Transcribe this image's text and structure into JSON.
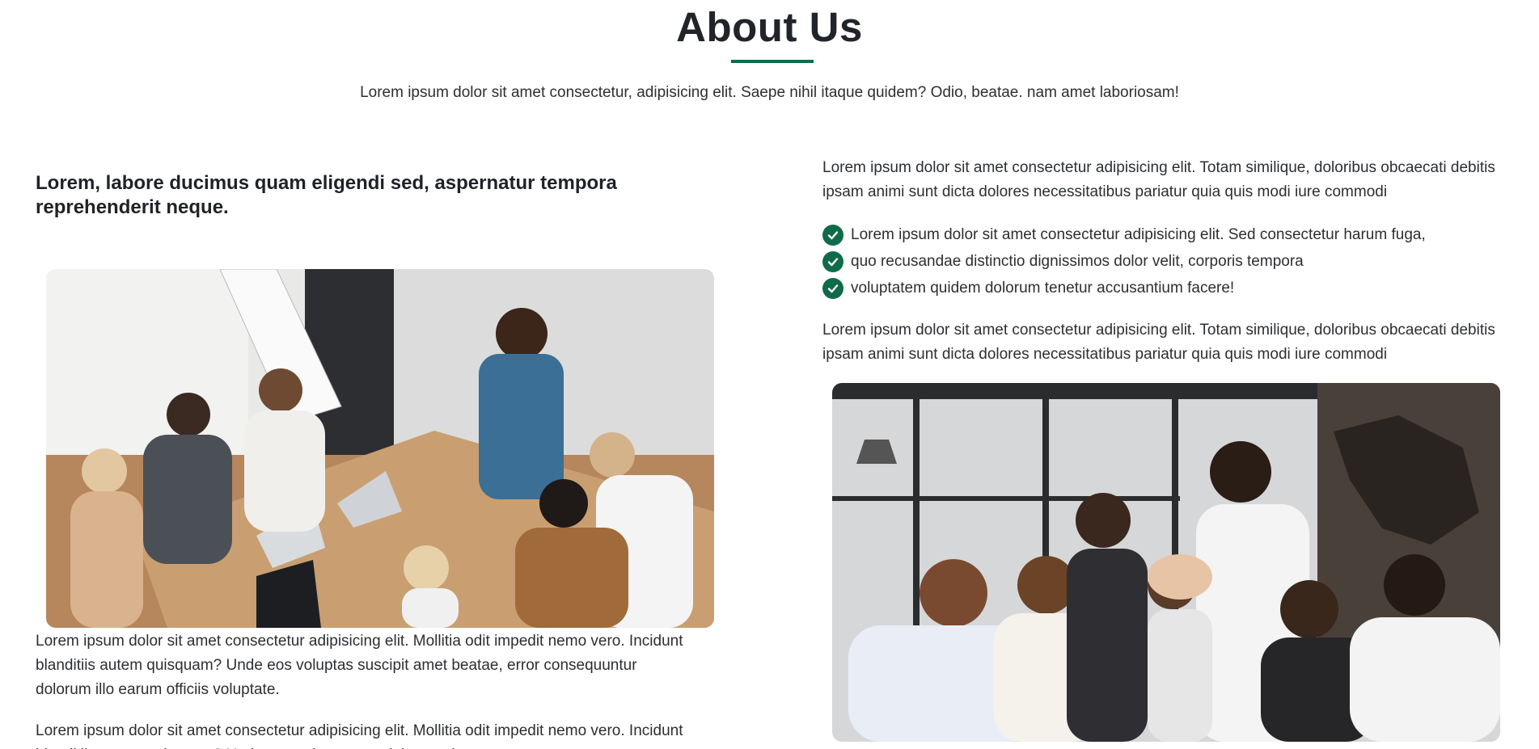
{
  "header": {
    "title": "About Us",
    "subtitle": "Lorem ipsum dolor sit amet consectetur, adipisicing elit. Saepe nihil itaque quidem? Odio, beatae. nam amet laboriosam!"
  },
  "left": {
    "heading": "Lorem, labore ducimus quam eligendi sed, aspernatur tempora reprehenderit neque.",
    "image": "business-meeting-photo",
    "paragraphs": [
      "Lorem ipsum dolor sit amet consectetur adipisicing elit. Mollitia odit impedit nemo vero. Incidunt blanditiis autem quisquam? Unde eos voluptas suscipit amet beatae, error consequuntur dolorum illo earum officiis voluptate.",
      "Lorem ipsum dolor sit amet consectetur adipisicing elit. Mollitia odit impedit nemo vero. Incidunt blanditiis autem quisquam? Unde eos voluptas suscipit amet beatae, error"
    ]
  },
  "right": {
    "intro": "Lorem ipsum dolor sit amet consectetur adipisicing elit. Totam similique, doloribus obcaecati debitis ipsam animi sunt dicta dolores necessitatibus pariatur quia quis modi iure commodi",
    "checklist": [
      "Lorem ipsum dolor sit amet consectetur adipisicing elit. Sed consectetur harum fuga,",
      "quo recusandae distinctio dignissimos dolor velit, corporis tempora",
      "voluptatem quidem dolorum tenetur accusantium facere!"
    ],
    "outro": "Lorem ipsum dolor sit amet consectetur adipisicing elit. Totam similique, doloribus obcaecati debitis ipsam animi sunt dicta dolores necessitatibus pariatur quia quis modi iure commodi",
    "image": "team-high-five-photo",
    "check_icon": "check-circle-icon"
  },
  "colors": {
    "accent": "#0f6b4a",
    "text": "#212529"
  }
}
